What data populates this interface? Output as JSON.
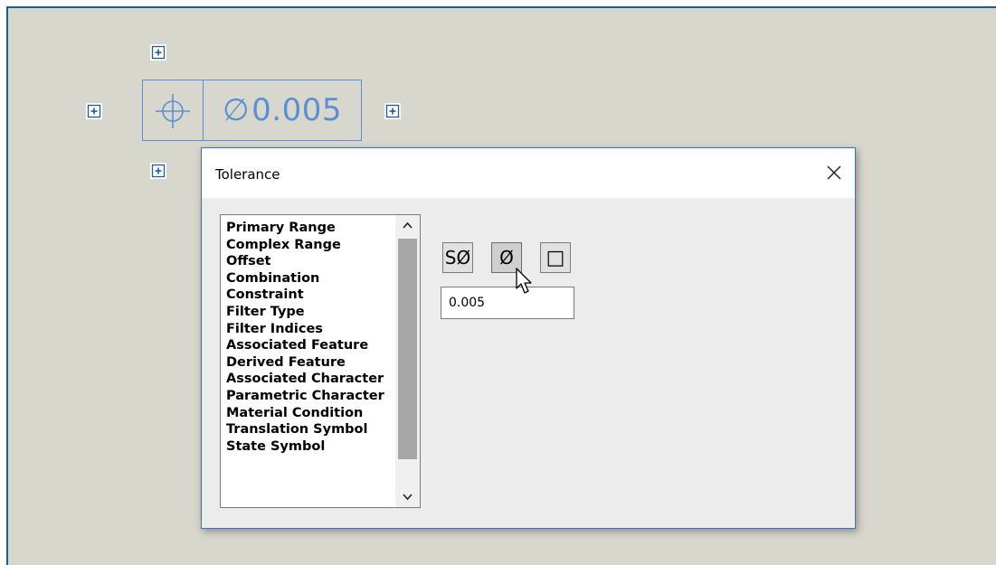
{
  "fcf": {
    "symbol_icon": "position-icon",
    "diameter_symbol": "∅",
    "tolerance_value": "0.005"
  },
  "dialog": {
    "title": "Tolerance",
    "close_icon": "close-icon",
    "list_items": [
      "Primary Range",
      "Complex Range",
      "Offset",
      "Combination",
      "Constraint",
      "Filter Type",
      "Filter Indices",
      "Associated Feature",
      "Derived Feature",
      "Associated Character",
      "Parametric Character",
      "Material Condition",
      "Translation Symbol",
      "State Symbol"
    ],
    "buttons": {
      "spherical_diameter": "SØ",
      "diameter": "Ø",
      "square": "□"
    },
    "value": "0.005"
  },
  "colors": {
    "canvas": "#d8d7cd",
    "fcf_blue": "#5b8fd1",
    "dialog_border": "#3a73c4"
  }
}
